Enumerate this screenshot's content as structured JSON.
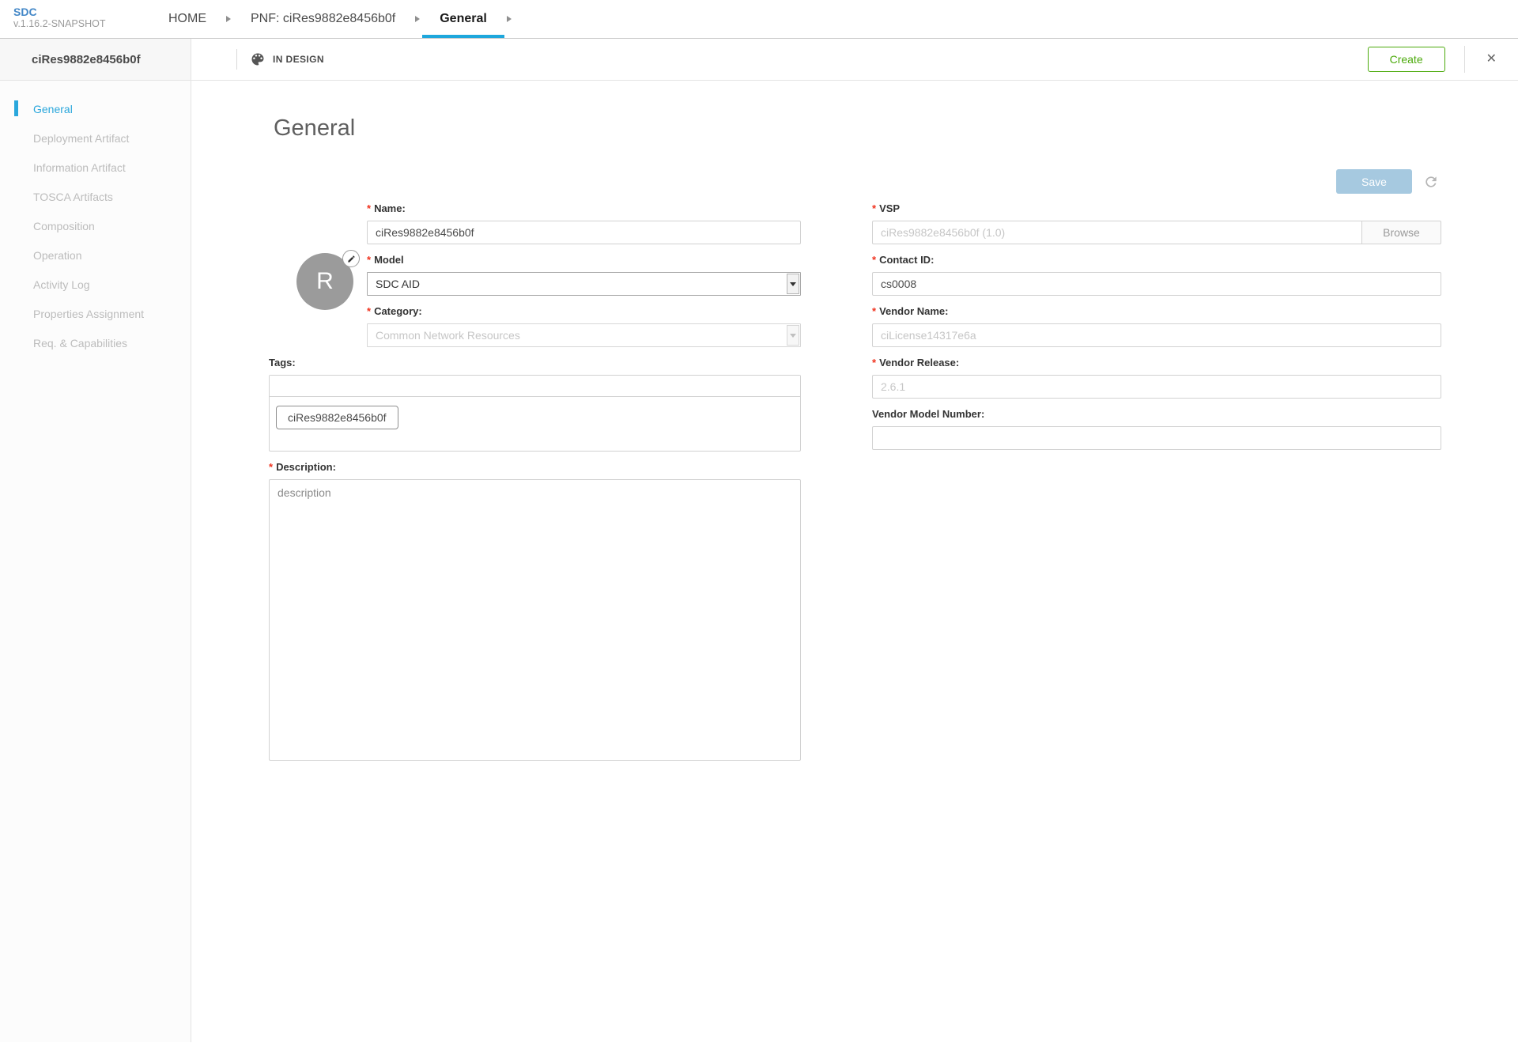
{
  "topbar": {
    "logo": {
      "name": "SDC",
      "version": "v.1.16.2-SNAPSHOT"
    },
    "tabs": [
      {
        "label": "HOME",
        "active": false
      },
      {
        "label": "PNF: ciRes9882e8456b0f",
        "active": false
      },
      {
        "label": "General",
        "active": true
      }
    ]
  },
  "workspace_header": {
    "resource_name": "ciRes9882e8456b0f",
    "lifecycle_status": "IN DESIGN",
    "create_button": "Create",
    "close_glyph": "✕"
  },
  "sidebar": {
    "items": [
      {
        "label": "General",
        "active": true
      },
      {
        "label": "Deployment Artifact",
        "active": false
      },
      {
        "label": "Information Artifact",
        "active": false
      },
      {
        "label": "TOSCA Artifacts",
        "active": false
      },
      {
        "label": "Composition",
        "active": false
      },
      {
        "label": "Operation",
        "active": false
      },
      {
        "label": "Activity Log",
        "active": false
      },
      {
        "label": "Properties Assignment",
        "active": false
      },
      {
        "label": "Req. & Capabilities",
        "active": false
      }
    ]
  },
  "main": {
    "page_title": "General",
    "save_button": "Save",
    "required_mark": "*",
    "avatar_letter": "R",
    "fields": {
      "name": {
        "label": "Name:",
        "value": "ciRes9882e8456b0f"
      },
      "model": {
        "label": "Model",
        "value": "SDC AID"
      },
      "category": {
        "label": "Category:",
        "value": "Common Network Resources"
      },
      "tags": {
        "label": "Tags:",
        "input_value": "",
        "chip": "ciRes9882e8456b0f"
      },
      "description": {
        "label": "Description:",
        "value": "description"
      },
      "vsp": {
        "label": "VSP",
        "value": "ciRes9882e8456b0f (1.0)",
        "browse_button": "Browse"
      },
      "contact": {
        "label": "Contact ID:",
        "value": "cs0008"
      },
      "vendor_name": {
        "label": "Vendor Name:",
        "value": "ciLicense14317e6a"
      },
      "vendor_release": {
        "label": "Vendor Release:",
        "value": "2.6.1"
      },
      "vendor_model_number": {
        "label": "Vendor Model Number:",
        "value": ""
      }
    }
  },
  "icons": {
    "status": "palette-icon",
    "close": "close-icon",
    "refresh": "refresh-icon",
    "edit": "pencil-icon",
    "breadcrumb": "arrow-right-icon",
    "dropdown": "caret-down-icon"
  },
  "colors": {
    "accent_blue": "#1ea7dc",
    "sidebar_active_blue": "#2aa7dc",
    "logo_blue": "#4387c7",
    "create_green": "#4caa0c",
    "save_disabled_blue": "#a6c9e0",
    "required_red": "#f0321e"
  }
}
